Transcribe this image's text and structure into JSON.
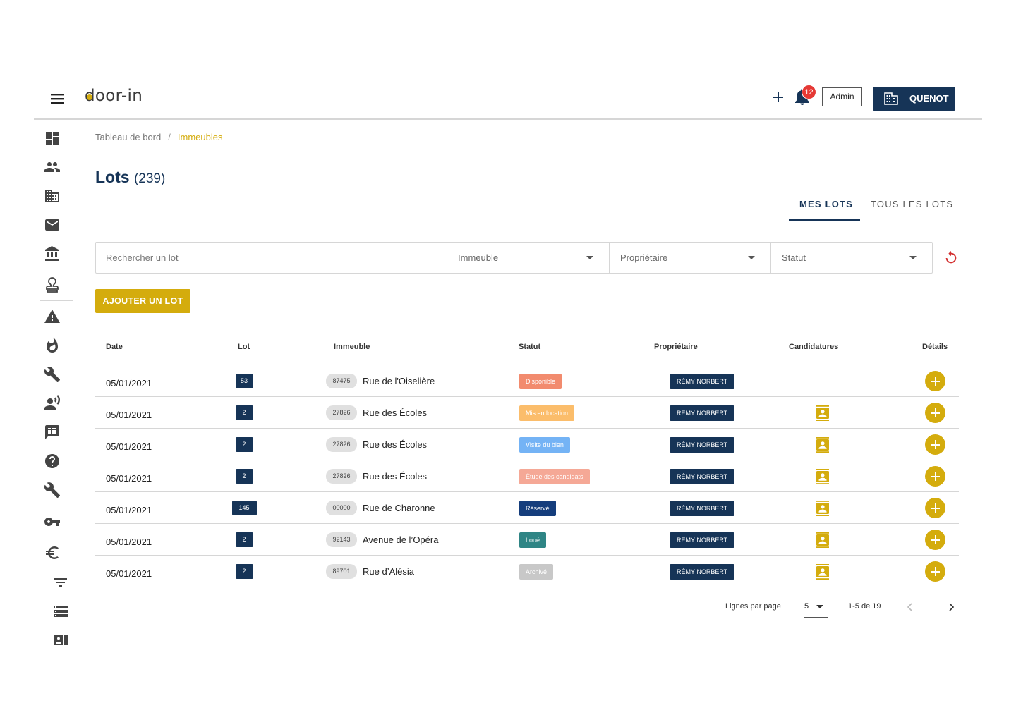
{
  "app": {
    "logo": "door-in",
    "notification_count": "12",
    "admin_label": "Admin",
    "company_label": "QUENOT"
  },
  "sidebar": {
    "items": [
      "dashboard-icon",
      "people-icon",
      "building-icon",
      "mail-icon",
      "bank-icon",
      "stamp-icon",
      "warning-icon",
      "fire-icon",
      "wrench-icon",
      "speaker-icon",
      "feed-icon",
      "help-icon",
      "build-icon",
      "key-icon",
      "euro-icon",
      "filter-icon",
      "list-icon",
      "badge-icon"
    ]
  },
  "breadcrumb": {
    "root": "Tableau de bord",
    "separator": "/",
    "current": "Immeubles"
  },
  "page": {
    "title": "Lots",
    "count": "(239)"
  },
  "tabs": {
    "mine": "MES LOTS",
    "all": "TOUS LES LOTS"
  },
  "filters": {
    "search_placeholder": "Rechercher un lot",
    "building": "Immeuble",
    "owner": "Propriétaire",
    "status": "Statut"
  },
  "actions": {
    "add_lot": "AJOUTER UN LOT"
  },
  "table": {
    "headers": {
      "date": "Date",
      "lot": "Lot",
      "building": "Immeuble",
      "status": "Statut",
      "owner": "Propriétaire",
      "applications": "Candidatures",
      "details": "Détails"
    },
    "rows": [
      {
        "date": "05/01/2021",
        "lot": "53",
        "code": "87475",
        "street": "Rue de l'Oiselière",
        "status": "Disponible",
        "status_color": "#f28b6e",
        "owner": "RÉMY NORBERT",
        "has_applications": false
      },
      {
        "date": "05/01/2021",
        "lot": "2",
        "code": "27826",
        "street": "Rue des Écoles",
        "status": "Mis en location",
        "status_color": "#fbbd6b",
        "owner": "RÉMY NORBERT",
        "has_applications": true
      },
      {
        "date": "05/01/2021",
        "lot": "2",
        "code": "27826",
        "street": "Rue des Écoles",
        "status": "Visite du bien",
        "status_color": "#74b3f5",
        "owner": "RÉMY NORBERT",
        "has_applications": true
      },
      {
        "date": "05/01/2021",
        "lot": "2",
        "code": "27826",
        "street": "Rue des Écoles",
        "status": "Étude des candidats",
        "status_color": "#f5a896",
        "owner": "RÉMY NORBERT",
        "has_applications": true
      },
      {
        "date": "05/01/2021",
        "lot": "145",
        "code": "00000",
        "street": "Rue de Charonne",
        "status": "Réservé",
        "status_color": "#153d7c",
        "owner": "RÉMY NORBERT",
        "has_applications": true
      },
      {
        "date": "05/01/2021",
        "lot": "2",
        "code": "92143",
        "street": "Avenue de l’Opéra",
        "status": "Loué",
        "status_color": "#2f8585",
        "owner": "RÉMY NORBERT",
        "has_applications": true
      },
      {
        "date": "05/01/2021",
        "lot": "2",
        "code": "89701",
        "street": "Rue d’Alésia",
        "status": "Archivé",
        "status_color": "#c8c8c8",
        "owner": "RÉMY NORBERT",
        "has_applications": true
      }
    ]
  },
  "pagination": {
    "rows_label": "Lignes par page",
    "rows_value": "5",
    "range": "1-5 de 19"
  },
  "colors": {
    "primary": "#163457",
    "accent": "#d4ac0d",
    "notification": "#e53935"
  }
}
